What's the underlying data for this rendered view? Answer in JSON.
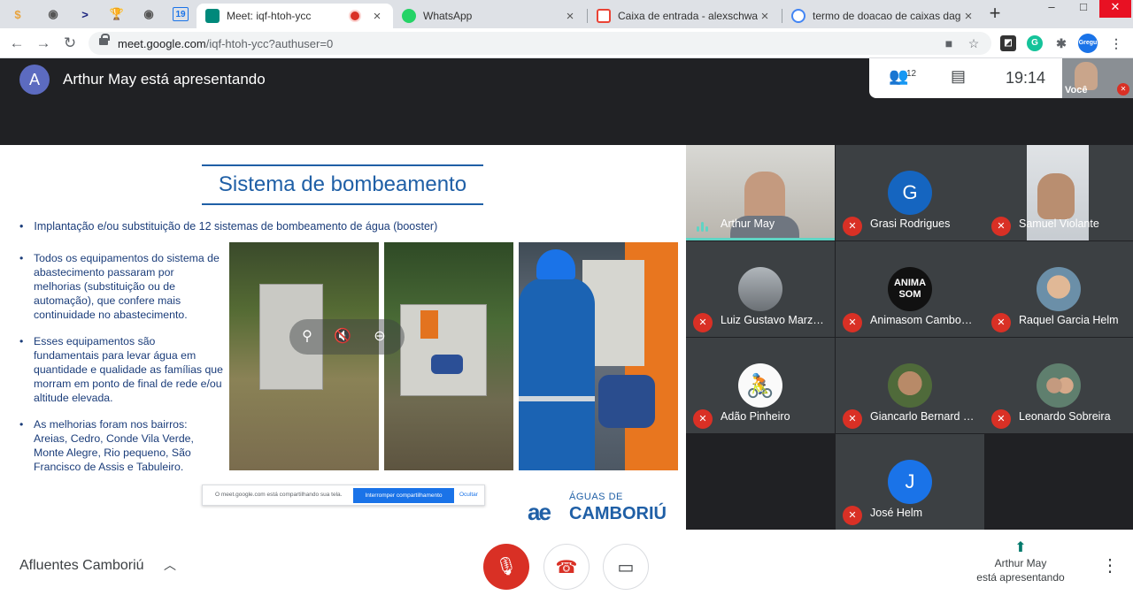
{
  "browser": {
    "pinned": [
      "$",
      "◉",
      ">",
      "🏆",
      "◉",
      "19"
    ],
    "tabs": [
      {
        "title": "Meet: iqf-htoh-ycc",
        "color": "#00897b"
      },
      {
        "title": "WhatsApp",
        "color": "#25d366"
      },
      {
        "title": "Caixa de entrada - alexschwabe",
        "color": "#ea4335"
      },
      {
        "title": "termo de doacao de caixas dagua",
        "color": "#4285f4"
      }
    ],
    "url_host": "meet.google.com",
    "url_path": "/iqf-htoh-ycc?authuser=0",
    "ext_label": "Gregu"
  },
  "meet": {
    "presenter_initial": "A",
    "presenter_text": "Arthur May está apresentando",
    "participant_count": "12",
    "time": "19:14",
    "self_label": "Você",
    "meeting_name": "Afluentes Camboriú",
    "presenting_label_1": "Arthur May",
    "presenting_label_2": "está apresentando"
  },
  "slide": {
    "title": "Sistema de bombeamento",
    "lead": "Implantação e/ou substituição de 12 sistemas de bombeamento de água (booster)",
    "bullets": [
      "Todos os equipamentos do sistema de abastecimento passaram por melhorias (substituição ou de automação), que confere mais continuidade no abastecimento.",
      "Esses equipamentos são fundamentais para levar água em quantidade e qualidade as famílias que morram em ponto de final de rede e/ou altitude elevada.",
      "As melhorias foram nos bairros: Areias, Cedro, Conde Vila Verde, Monte Alegre, Rio pequeno, São Francisco de Assis  e Tabuleiro."
    ],
    "sharebar_text": "O meet.google.com está compartilhando sua tela.",
    "sharebar_stop": "Interromper compartilhamento",
    "sharebar_hide": "Ocultar",
    "logo_sub": "ÁGUAS DE",
    "logo_mark": "ae",
    "logo_main": "CAMBORIÚ"
  },
  "participants": [
    {
      "name": "Arthur May",
      "type": "video",
      "speaking": true
    },
    {
      "name": "Grasi Rodrigues",
      "type": "avatar",
      "initial": "G",
      "color": "#1565c0",
      "muted": true
    },
    {
      "name": "Samuel Violante",
      "type": "video",
      "muted": true
    },
    {
      "name": "Luiz Gustavo Marz…",
      "type": "photo",
      "color": "#8a9096",
      "muted": true
    },
    {
      "name": "Animasom Cambo…",
      "type": "avatar",
      "initial": "ANIMA SOM",
      "color": "#111111",
      "muted": true
    },
    {
      "name": "Raquel Garcia Helm",
      "type": "photo",
      "color": "#c89f7c",
      "muted": true
    },
    {
      "name": "Adão Pinheiro",
      "type": "photo",
      "color": "#f0f0f0",
      "muted": true
    },
    {
      "name": "Giancarlo Bernard …",
      "type": "photo",
      "color": "#6b8a4a",
      "muted": true
    },
    {
      "name": "Leonardo Sobreira",
      "type": "photo",
      "color": "#7a9a8a",
      "muted": true
    },
    {
      "name": "José Helm",
      "type": "avatar",
      "initial": "J",
      "color": "#1a73e8",
      "muted": true
    }
  ]
}
